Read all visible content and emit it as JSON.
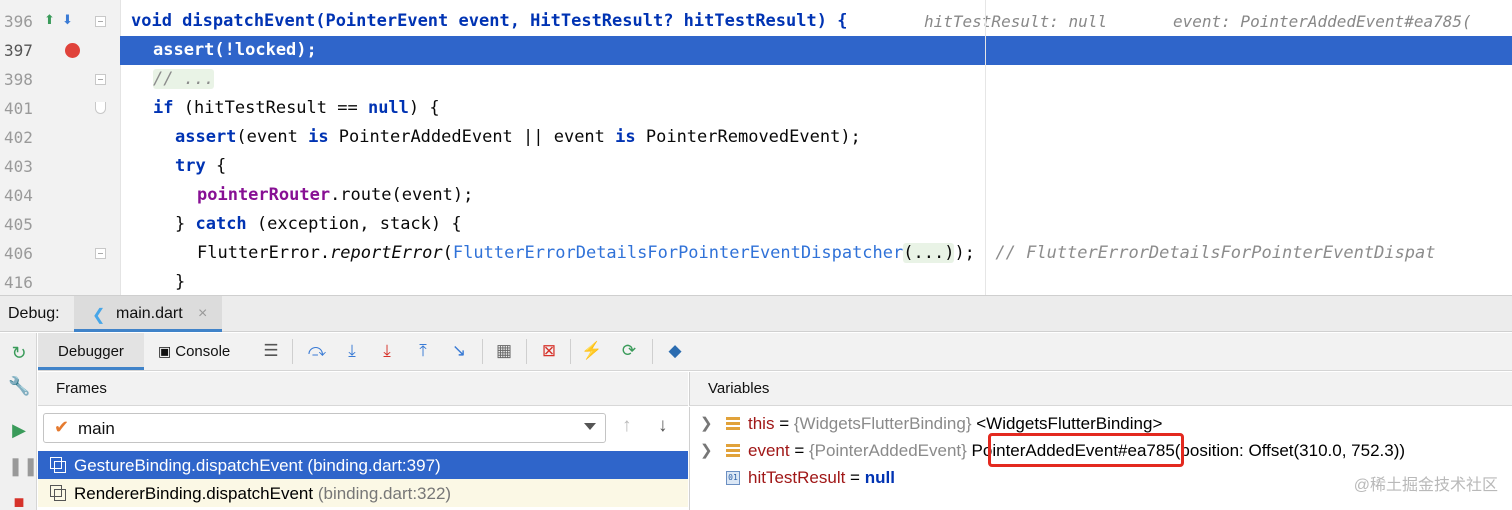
{
  "editor": {
    "lines": [
      {
        "no": "396",
        "text": "void dispatchEvent(PointerEvent event, HitTestResult? hitTestResult) {",
        "hint1": "hitTestResult: null",
        "hint2": "event: PointerAddedEvent#ea785("
      },
      {
        "no": "397",
        "text": "assert(!locked);"
      },
      {
        "no": "398",
        "text": "// ..."
      },
      {
        "no": "401",
        "text_a": "if",
        "text_b": " (hitTestResult == ",
        "text_c": "null",
        "text_d": ") {"
      },
      {
        "no": "402",
        "text_a": "assert",
        "text_b": "(event ",
        "text_c": "is",
        "text_d": " PointerAddedEvent || event ",
        "text_e": "is",
        "text_f": " PointerRemovedEvent);"
      },
      {
        "no": "403",
        "text_a": "try",
        "text_b": " {"
      },
      {
        "no": "404",
        "text_a": "pointerRouter",
        "text_b": ".route(event);"
      },
      {
        "no": "405",
        "text_a": "} ",
        "text_b": "catch",
        "text_c": " (exception, stack) {"
      },
      {
        "no": "406",
        "text_a": "FlutterError.",
        "text_b": "reportError",
        "text_c": "(",
        "text_d": "FlutterErrorDetailsForPointerEventDispatcher",
        "text_e": "(...)",
        "text_f": ");",
        "comment": "// FlutterErrorDetailsForPointerEventDispat"
      },
      {
        "no": "416",
        "text": "}"
      }
    ]
  },
  "debug": {
    "label": "Debug:",
    "run_tab": "main.dart",
    "close": "×",
    "tabs": {
      "debugger": "Debugger",
      "console": "Console"
    }
  },
  "frames": {
    "title": "Frames",
    "thread": "main",
    "rows": [
      {
        "method": "GestureBinding.dispatchEvent",
        "location": " (binding.dart:397)"
      },
      {
        "method": "RendererBinding.dispatchEvent",
        "location": " (binding.dart:322)"
      }
    ]
  },
  "variables": {
    "title": "Variables",
    "rows": [
      {
        "name": "this",
        "eq": " = ",
        "type": "{WidgetsFlutterBinding}",
        "value": " <WidgetsFlutterBinding>"
      },
      {
        "name": "event",
        "eq": " = ",
        "type": "{PointerAddedEvent}",
        "value": " PointerAddedEvent#ea785(position: Offset(310.0, 752.3))"
      },
      {
        "name": "hitTestResult",
        "eq": " = ",
        "value": "null"
      }
    ]
  },
  "watermark": "@稀土掘金技术社区",
  "colors": {
    "selection": "#2f65ca",
    "breakpoint": "#e0433b",
    "highlight_box": "#e3291f"
  }
}
